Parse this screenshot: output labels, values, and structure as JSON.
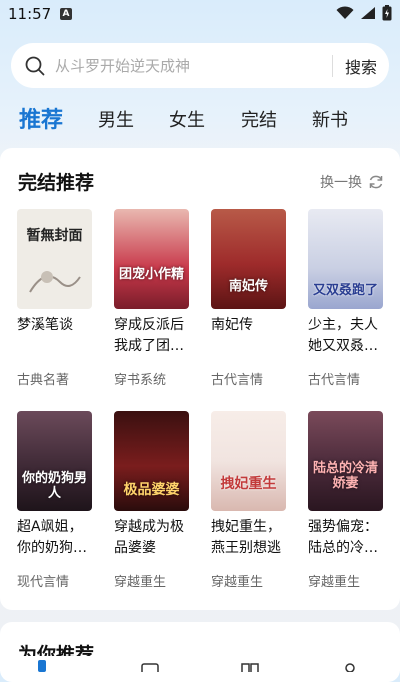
{
  "status": {
    "time": "11:57",
    "badge": "A"
  },
  "search": {
    "placeholder": "从斗罗开始逆天成神",
    "button": "搜索"
  },
  "tabs": [
    "推荐",
    "男生",
    "女生",
    "完结",
    "新书"
  ],
  "section1": {
    "title": "完结推荐",
    "refresh_label": "换一换"
  },
  "books": [
    {
      "title": "梦溪笔谈",
      "category": "古典名著",
      "cover_text": "暂無封面",
      "cover_bg": "#efece6",
      "cover_color": "#222"
    },
    {
      "title": "穿成反派后我成了团…",
      "category": "穿书系统",
      "cover_text": "团宠小作精",
      "cover_bg": "#c8384a",
      "cover_color": "#fff"
    },
    {
      "title": "南妃传",
      "category": "古代言情",
      "cover_text": "南妃传",
      "cover_bg": "#9e2b2b",
      "cover_color": "#fff"
    },
    {
      "title": "少主，夫人她又双叒…",
      "category": "古代言情",
      "cover_text": "又双叒跑了",
      "cover_bg": "#c9cfe3",
      "cover_color": "#2a3e92"
    },
    {
      "title": "超A飒姐，你的奶狗…",
      "category": "现代言情",
      "cover_text": "你的奶狗男人",
      "cover_bg": "#3b2733",
      "cover_color": "#fff"
    },
    {
      "title": "穿越成为极品婆婆",
      "category": "穿越重生",
      "cover_text": "极品婆婆",
      "cover_bg": "#7a1d1d",
      "cover_color": "#ffd36b"
    },
    {
      "title": "拽妃重生，燕王别想逃",
      "category": "穿越重生",
      "cover_text": "拽妃重生",
      "cover_bg": "#f1e4e0",
      "cover_color": "#c23a3a"
    },
    {
      "title": "强势偏宠：陆总的冷…",
      "category": "穿越重生",
      "cover_text": "陆总的冷清娇妻",
      "cover_bg": "#4a2a3a",
      "cover_color": "#ffb3b3"
    }
  ],
  "section2": {
    "title": "为你推荐"
  },
  "icons": {
    "search": "search-icon",
    "refresh": "refresh-icon",
    "wifi": "wifi-icon",
    "signal": "signal-icon",
    "battery": "battery-icon"
  },
  "colors": {
    "accent": "#1976d2"
  }
}
